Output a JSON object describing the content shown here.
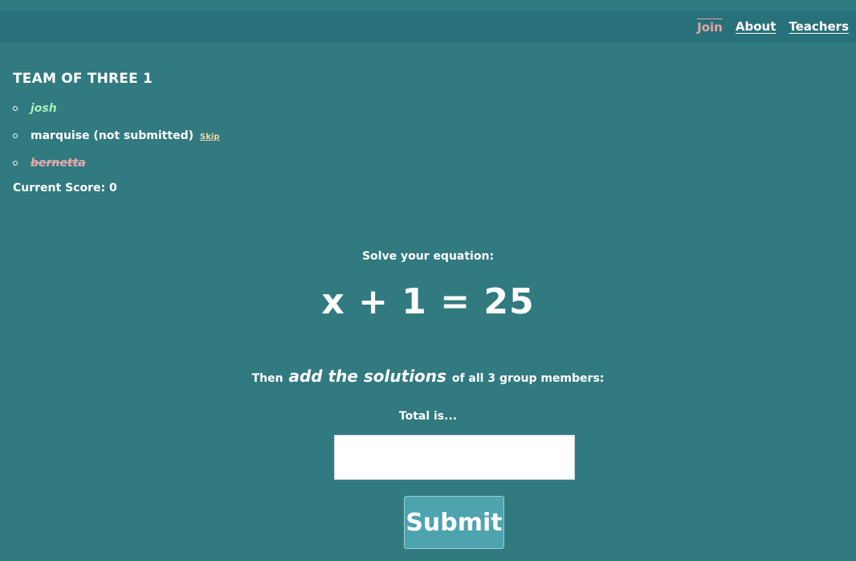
{
  "nav": {
    "join": "Join",
    "about": "About",
    "teachers": "Teachers"
  },
  "team": {
    "title": "TEAM OF THREE 1",
    "members": [
      {
        "name": "josh",
        "status": "submitted"
      },
      {
        "name": "marquise (not submitted)",
        "status": "pending",
        "action": "Skip"
      },
      {
        "name": "bernetta",
        "status": "skipped"
      }
    ],
    "score_label": "Current Score: 0"
  },
  "task": {
    "prompt": "Solve your equation:",
    "equation": "x + 1 = 25",
    "instruction_before": "Then",
    "instruction_emphasis": "add the solutions",
    "instruction_after": "of all 3 group members:",
    "total_label": "Total is...",
    "answer_value": "",
    "submit_label": "Submit"
  },
  "colors": {
    "background": "#307a80",
    "navbar": "#28717a",
    "active_nav": "#e3a5a0",
    "submitted": "#a8f0b8",
    "skipped": "#e8a9a9",
    "button": "#4da3ae"
  }
}
